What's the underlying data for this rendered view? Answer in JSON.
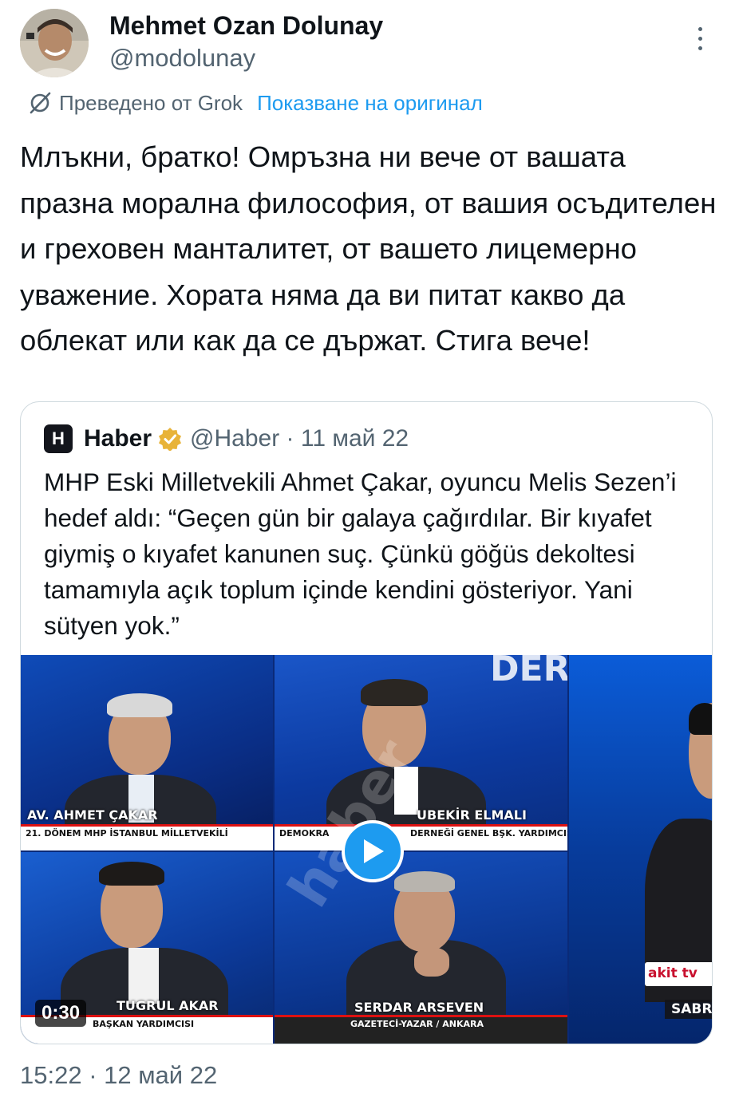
{
  "author": {
    "name": "Mehmet Ozan Dolunay",
    "handle": "@modolunay"
  },
  "translation": {
    "label": "Преведено от Grok",
    "show_original": "Показване на оригинал"
  },
  "tweet": {
    "text": "Млъкни, братко! Омръзна ни вече от вашата празна морална философия, от вашия осъдителен и греховен манталитет, от вашето лицемерно уважение. Хората няма да ви питат какво да облекат или как да се държат. Стига вече!",
    "timestamp": "15:22 · 12 май 22"
  },
  "quote": {
    "logo_letter": "H",
    "name": "Haber",
    "handle_date": "@Haber · 11 май 22",
    "text": "MHP Eski Milletvekili Ahmet Çakar, oyuncu Melis Sezen’i hedef aldı: “Geçen gün bir galaya çağırdılar. Bir kıyafet giymiş o kıyafet kanunen suç. Çünkü göğüs dekoltesi tamamıyla açık toplum içinde kendini gösteriyor. Yani sütyen yok.”",
    "video": {
      "duration": "0:30",
      "panels": {
        "p1_name": "AV. AHMET ÇAKAR",
        "p1_sub": "21. DÖNEM MHP İSTANBUL MİLLETVEKİLİ",
        "p2_name": "UBEKİR ELMALI",
        "p2_sub": "DERNEĞİ GENEL BŞK. YARDIMCISI",
        "p2_sub_left": "DEMOKRA",
        "p3_name": "TUGRUL AKAR",
        "p3_sub": "BAŞKAN YARDIMCISI",
        "p4_name": "SERDAR ARSEVEN",
        "p4_sub": "GAZETECİ-YAZAR / ANKARA",
        "p5_name": "SABRİ B",
        "p5_logo": "akit tv",
        "top_text": "DER"
      }
    }
  },
  "colors": {
    "accent": "#1d9bf0",
    "secondary_text": "#536471",
    "primary_text": "#0f1419",
    "verified_gold": "#e8b339"
  }
}
